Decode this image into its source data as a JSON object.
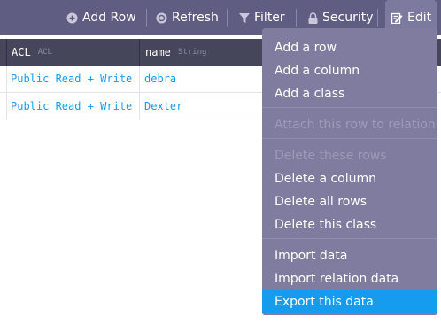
{
  "toolbar": {
    "add_row": "Add Row",
    "refresh": "Refresh",
    "filter": "Filter",
    "security": "Security",
    "edit": "Edit"
  },
  "columns": [
    {
      "name": "ACL",
      "type": "ACL"
    },
    {
      "name": "name",
      "type": "String"
    }
  ],
  "rows": [
    {
      "acl": "Public Read + Write",
      "name": "debra"
    },
    {
      "acl": "Public Read + Write",
      "name": "Dexter"
    }
  ],
  "edit_menu": {
    "add_row": "Add a row",
    "add_column": "Add a column",
    "add_class": "Add a class",
    "attach_relation": "Attach this row to relation",
    "delete_rows": "Delete these rows",
    "delete_column": "Delete a column",
    "delete_all_rows": "Delete all rows",
    "delete_class": "Delete this class",
    "import_data": "Import data",
    "import_relation_data": "Import relation data",
    "export_data": "Export this data"
  },
  "colors": {
    "toolbar": "#5f5d81",
    "header": "#454659",
    "menu": "#7f7c9f",
    "highlight": "#169cee",
    "link": "#169cee"
  }
}
